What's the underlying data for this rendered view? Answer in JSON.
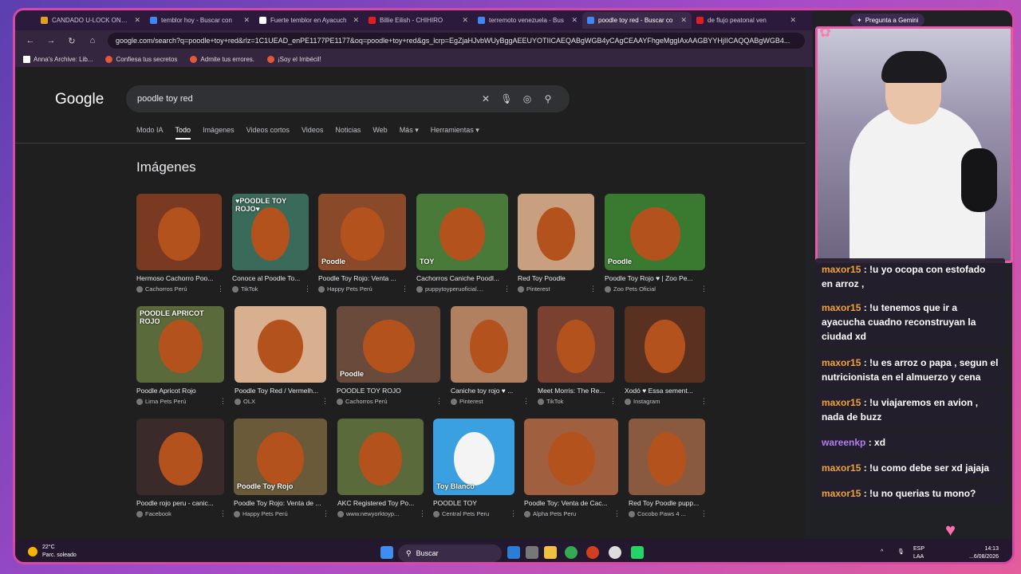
{
  "tabs": [
    {
      "title": "CANDADO U-LOCK ONGU",
      "color": "#e0a020"
    },
    {
      "title": "temblor hoy - Buscar con",
      "color": "#4285f4"
    },
    {
      "title": "Fuerte temblor en Ayacuch",
      "color": "#ffffff"
    },
    {
      "title": "Billie Eilish - CHIHIRO",
      "color": "#e02020"
    },
    {
      "title": "terremoto venezuela - Bus",
      "color": "#4285f4"
    },
    {
      "title": "poodle toy red - Buscar co",
      "color": "#4285f4"
    },
    {
      "title": "de flujo peatonal ven",
      "color": "#e02020"
    }
  ],
  "gemini_label": "Pregunta a Gemini",
  "url": "google.com/search?q=poodle+toy+red&rlz=1C1UEAD_enPE1177PE1177&oq=poodle+toy+red&gs_lcrp=EgZjaHJvbWUyBggAEEUYOTIICAEQABgWGB4yCAgCEAAYFhgeMggIAxAAGBYYHjIICAQQABgWGB4...",
  "bookmarks": [
    "Anna's Archive: Lib...",
    "Confiesa tus secretos",
    "Admite tus errores.",
    "¡Soy el Imbécil!"
  ],
  "search": {
    "logo": "Google",
    "query": "poodle toy red"
  },
  "navtabs": [
    "Modo IA",
    "Todo",
    "Imágenes",
    "Videos cortos",
    "Videos",
    "Noticias",
    "Web",
    "Más ▾",
    "Herramientas ▾"
  ],
  "section_title": "Imágenes",
  "images": [
    {
      "cap": "Hermoso Cachorro Poo...",
      "src": "Cachorros Perú"
    },
    {
      "cap": "Conoce al Poodle To...",
      "src": "TikTok",
      "overlay": "♥POODLE TOY ROJO♥"
    },
    {
      "cap": "Poodle Toy Rojo: Venta ...",
      "src": "Happy Pets Perú",
      "overlay": "Poodle"
    },
    {
      "cap": "Cachorros Caniche Poodl...",
      "src": "puppytoyperuoficial....",
      "overlay": "TOY"
    },
    {
      "cap": "Red Toy Poodle",
      "src": "Pinterest"
    },
    {
      "cap": "Poodle Toy Rojo ♥ | Zoo Pe...",
      "src": "Zoo Pets Oficial",
      "overlay": "Poodle"
    },
    {
      "cap": "Poodle Apricot Rojo",
      "src": "Lima Pets Perú",
      "overlay": "POODLE APRICOT ROJO"
    },
    {
      "cap": "Poodle Toy Red / Vermelh...",
      "src": "OLX"
    },
    {
      "cap": "POODLE TOY ROJO",
      "src": "Cachorros Perú",
      "overlay": "Poodle"
    },
    {
      "cap": "Caniche toy rojo ♥ ...",
      "src": "Pinterest"
    },
    {
      "cap": "Meet Morris: The Re...",
      "src": "TikTok"
    },
    {
      "cap": "Xodó ♥ Essa sement...",
      "src": "Instagram"
    },
    {
      "cap": "Poodle rojo peru - canic...",
      "src": "Facebook"
    },
    {
      "cap": "Poodle Toy Rojo: Venta de ...",
      "src": "Happy Pets Perú",
      "overlay": "Poodle Toy Rojo"
    },
    {
      "cap": "AKC Registered Toy Po...",
      "src": "www.newyorktoyp..."
    },
    {
      "cap": "POODLE TOY",
      "src": "Central Pets Peru",
      "overlay": "Toy Blanco"
    },
    {
      "cap": "Poodle Toy: Venta de Cac...",
      "src": "Alpha Pets Peru"
    },
    {
      "cap": "Red Toy Poodle pupp...",
      "src": "Cocobo Paws 4 ..."
    }
  ],
  "chat": [
    {
      "user": "maxor15",
      "text": ": !u yo ocopa con estofado en arroz ,"
    },
    {
      "user": "maxor15",
      "text": ": !u tenemos que ir a ayacucha cuadno reconstruyan la ciudad xd"
    },
    {
      "user": "maxor15",
      "text": ": !u es arroz o papa , segun el nutricionista en el almuerzo y cena"
    },
    {
      "user": "maxor15",
      "text": ": !u viajaremos en avion , nada de buzz"
    },
    {
      "user": "wareenkp",
      "text": ": xd"
    },
    {
      "user": "maxor15",
      "text": ": !u como debe ser xd jajaja"
    },
    {
      "user": "maxor15",
      "text": ": !u no querias tu mono?"
    }
  ],
  "taskbar": {
    "temp": "22°C",
    "weather": "Parc. soleado",
    "search": "Buscar",
    "lang1": "ESP",
    "lang2": "LAA",
    "time": "14:13",
    "date": "...6/08/2026"
  }
}
